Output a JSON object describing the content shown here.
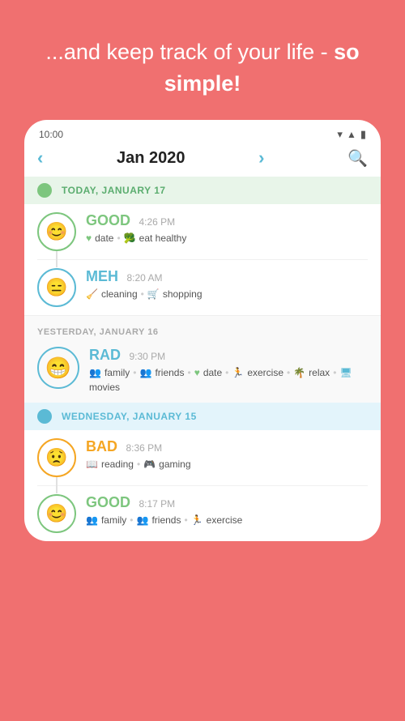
{
  "hero": {
    "text_plain": "...and keep track of your life - ",
    "text_bold": "so simple!"
  },
  "status_bar": {
    "time": "10:00",
    "wifi_icon": "▾",
    "signal_icon": "▲",
    "battery_icon": "🔋"
  },
  "nav": {
    "prev_arrow": "‹",
    "title": "Jan 2020",
    "next_arrow": "›",
    "search_icon": "🔍"
  },
  "days": [
    {
      "id": "today",
      "label": "TODAY, JANUARY 17",
      "type": "today",
      "entries": [
        {
          "mood": "GOOD",
          "time": "4:26 PM",
          "tags": [
            {
              "icon": "♥",
              "color": "green",
              "label": "date"
            },
            {
              "icon": "🥦",
              "color": "green",
              "label": "eat healthy"
            }
          ],
          "face": "😊",
          "mood_type": "good"
        },
        {
          "mood": "MEH",
          "time": "8:20 AM",
          "tags": [
            {
              "icon": "🧹",
              "color": "teal",
              "label": "cleaning"
            },
            {
              "icon": "🛒",
              "color": "teal",
              "label": "shopping"
            }
          ],
          "face": "😐",
          "mood_type": "meh"
        }
      ]
    },
    {
      "id": "yesterday",
      "label": "YESTERDAY, JANUARY 16",
      "type": "yesterday",
      "entries": [
        {
          "mood": "RAD",
          "time": "9:30 PM",
          "tags": [
            {
              "icon": "👥",
              "color": "teal",
              "label": "family"
            },
            {
              "icon": "👥",
              "color": "teal",
              "label": "friends"
            },
            {
              "icon": "♥",
              "color": "green",
              "label": "date"
            },
            {
              "icon": "🏃",
              "color": "teal",
              "label": "exercise"
            },
            {
              "icon": "🌴",
              "color": "teal",
              "label": "relax"
            },
            {
              "icon": "🖥",
              "color": "teal",
              "label": "movies"
            }
          ],
          "face": "😄",
          "mood_type": "rad"
        }
      ]
    },
    {
      "id": "wednesday",
      "label": "WEDNESDAY, JANUARY 15",
      "type": "wednesday",
      "entries": [
        {
          "mood": "BAD",
          "time": "8:36 PM",
          "tags": [
            {
              "icon": "📖",
              "color": "orange",
              "label": "reading"
            },
            {
              "icon": "🎮",
              "color": "orange",
              "label": "gaming"
            }
          ],
          "face": "😟",
          "mood_type": "bad"
        },
        {
          "mood": "GOOD",
          "time": "8:17 PM",
          "tags": [
            {
              "icon": "👥",
              "color": "green",
              "label": "family"
            },
            {
              "icon": "👥",
              "color": "green",
              "label": "friends"
            },
            {
              "icon": "🏃",
              "color": "green",
              "label": "exercise"
            }
          ],
          "face": "😊",
          "mood_type": "good"
        }
      ]
    }
  ],
  "colors": {
    "background": "#F07070",
    "good": "#7DC67E",
    "meh": "#5BBAD5",
    "rad": "#5BBAD5",
    "bad": "#F5A623",
    "today_bg": "#E8F5E9",
    "wednesday_bg": "#E3F4FB"
  }
}
